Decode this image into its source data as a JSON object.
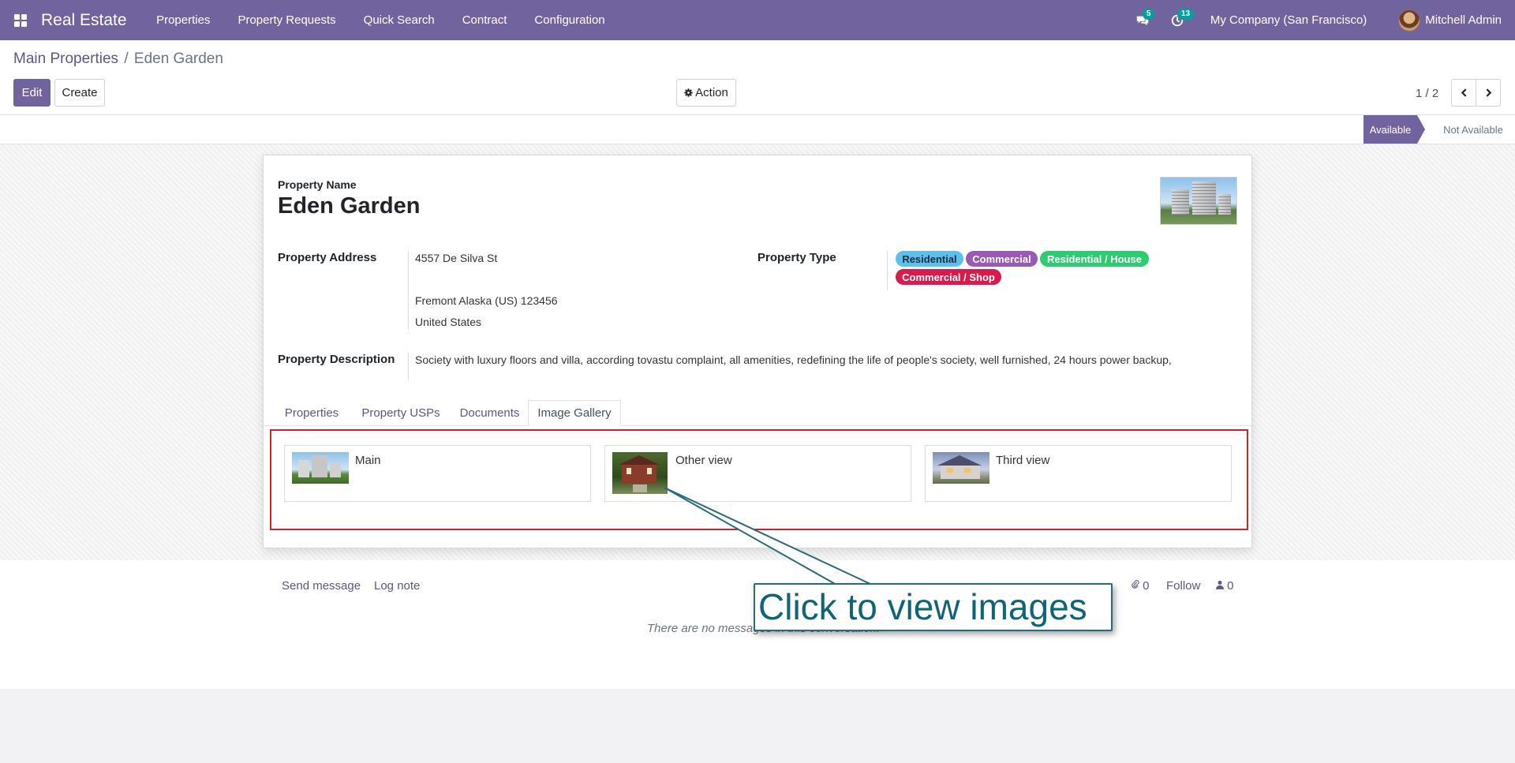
{
  "navbar": {
    "brand": "Real Estate",
    "menu": [
      "Properties",
      "Property Requests",
      "Quick Search",
      "Contract",
      "Configuration"
    ],
    "messages_count": "5",
    "activities_count": "13",
    "company": "My Company (San Francisco)",
    "user": "Mitchell Admin",
    "color": "#71639e"
  },
  "breadcrumb": {
    "parent": "Main Properties",
    "separator": "/",
    "current": "Eden Garden"
  },
  "buttons": {
    "edit": "Edit",
    "create": "Create",
    "action": "Action"
  },
  "pager": {
    "value": "1 / 2"
  },
  "statusbar": {
    "active": "Available",
    "inactive": "Not Available"
  },
  "record": {
    "name_label": "Property Name",
    "name": "Eden Garden",
    "address_label": "Property Address",
    "street": "4557 De Silva St",
    "city_line": "Fremont  Alaska (US)  123456",
    "country": "United States",
    "type_label": "Property Type",
    "tags": [
      {
        "label": "Residential",
        "color": "#5bc0eb",
        "text": "#1f2d3d"
      },
      {
        "label": "Commercial",
        "color": "#9b59b6",
        "text": "#ffffff"
      },
      {
        "label": "Residential / House",
        "color": "#2ecc71",
        "text": "#ffffff"
      },
      {
        "label": "Commercial / Shop",
        "color": "#d81b4d",
        "text": "#ffffff"
      }
    ],
    "description_label": "Property Description",
    "description": "Society with luxury floors and villa, according tovastu complaint, all amenities, redefining the life of people's society, well furnished, 24 hours power backup,"
  },
  "tabs": [
    "Properties",
    "Property USPs",
    "Documents",
    "Image Gallery"
  ],
  "active_tab": "Image Gallery",
  "gallery": [
    {
      "name": "Main",
      "icon": "apartment-photo"
    },
    {
      "name": "Other view",
      "icon": "house-photo"
    },
    {
      "name": "Third view",
      "icon": "villa-photo"
    }
  ],
  "chatter": {
    "send_message": "Send message",
    "log_note": "Log note",
    "attachments": "0",
    "follow": "Follow",
    "followers": "0",
    "empty": "There are no messages in this conversation."
  },
  "callout": {
    "text": "Click to view images",
    "highlight_color": "#d0222e"
  }
}
